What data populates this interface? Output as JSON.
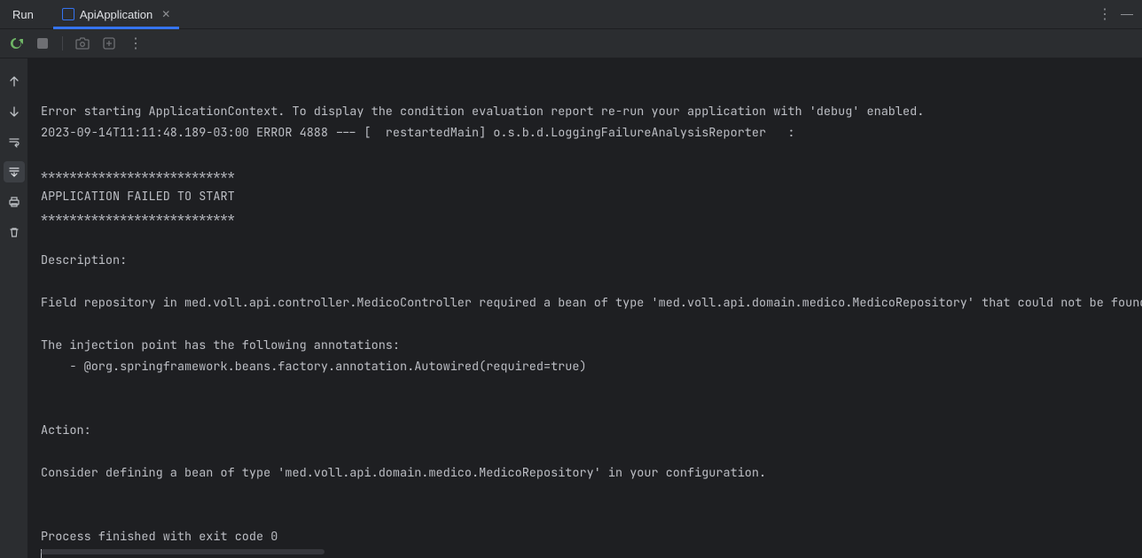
{
  "header": {
    "run_label": "Run",
    "tab_label": "ApiApplication"
  },
  "console": {
    "lines": [
      "",
      "Error starting ApplicationContext. To display the condition evaluation report re-run your application with 'debug' enabled.",
      "2023-09-14T11:11:48.189-03:00 ERROR 4888 --- [  restartedMain] o.s.b.d.LoggingFailureAnalysisReporter   :",
      "",
      "***************************",
      "APPLICATION FAILED TO START",
      "***************************",
      "",
      "Description:",
      "",
      "Field repository in med.voll.api.controller.MedicoController required a bean of type 'med.voll.api.domain.medico.MedicoRepository' that could not be found.",
      "",
      "The injection point has the following annotations:",
      "    - @org.springframework.beans.factory.annotation.Autowired(required=true)",
      "",
      "",
      "Action:",
      "",
      "Consider defining a bean of type 'med.voll.api.domain.medico.MedicoRepository' in your configuration.",
      "",
      "",
      "Process finished with exit code 0"
    ]
  }
}
